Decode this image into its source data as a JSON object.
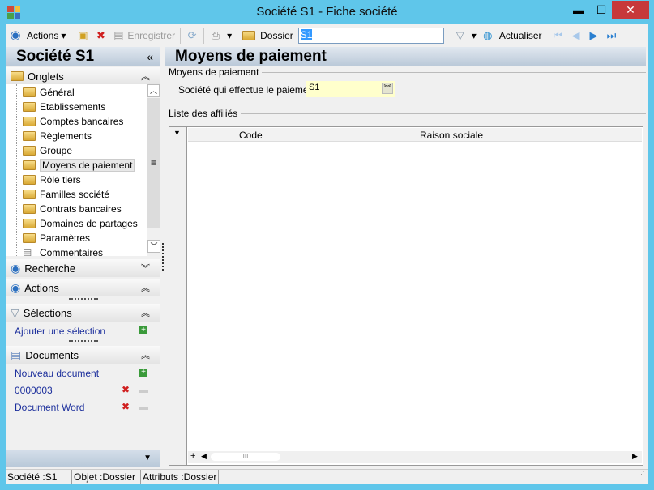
{
  "window": {
    "title": "Société S1 -  Fiche société",
    "minimize": "▬",
    "maximize": "☐",
    "close": "✕"
  },
  "toolbar": {
    "actions": "Actions",
    "save": "Enregistrer",
    "dossier": "Dossier",
    "dossier_value": "S1",
    "refresh": "Actualiser"
  },
  "left": {
    "title": "Société S1",
    "collapse": "«",
    "onglets": "Onglets",
    "tree": [
      "Général",
      "Etablissements",
      "Comptes bancaires",
      "Règlements",
      "Groupe",
      "Moyens de paiement",
      "Rôle tiers",
      "Familles société",
      "Contrats bancaires",
      "Domaines de partages",
      "Paramètres",
      "Commentaires"
    ],
    "selected": "Moyens de paiement",
    "recherche": "Recherche",
    "actions": "Actions",
    "selections": "Sélections",
    "add_selection": "Ajouter une sélection",
    "documents": "Documents",
    "new_document": "Nouveau document",
    "docs": [
      "0000003",
      "Document Word"
    ]
  },
  "main": {
    "title": "Moyens de paiement",
    "group1": "Moyens de paiement",
    "field_label": "Société qui effectue le paiement :",
    "field_value": "S1",
    "group2": "Liste des affiliés",
    "columns": [
      "Code",
      "Raison sociale"
    ]
  },
  "status": {
    "societe": "Société :S1",
    "objet": "Objet :Dossier",
    "attributs": "Attributs :Dossier"
  }
}
